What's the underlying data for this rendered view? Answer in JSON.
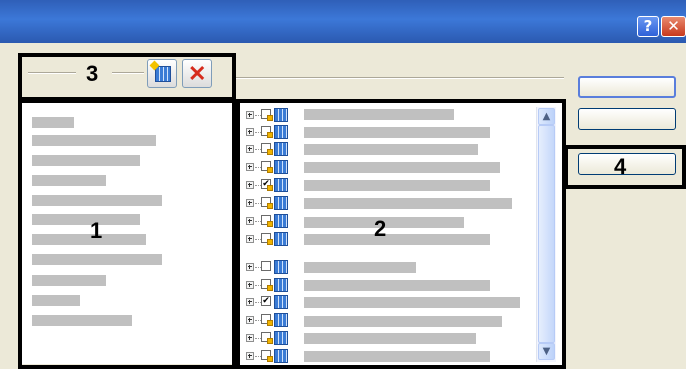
{
  "window": {
    "help_icon": "?",
    "close_icon": "✕"
  },
  "callouts": {
    "list_panel": "1",
    "tree_panel": "2",
    "toolbar": "3",
    "side_button": "4"
  },
  "toolbar": {
    "add_icon": "grid-add-icon",
    "delete_icon": "✕"
  },
  "list": {
    "items": [
      {
        "kind": "redacted-text"
      },
      {
        "kind": "redacted-text"
      },
      {
        "kind": "redacted-text"
      },
      {
        "kind": "redacted-text"
      },
      {
        "kind": "redacted-text"
      },
      {
        "kind": "redacted-text"
      },
      {
        "kind": "redacted-text"
      },
      {
        "kind": "redacted-text"
      },
      {
        "kind": "redacted-text"
      },
      {
        "kind": "redacted-text"
      },
      {
        "kind": "redacted-text"
      },
      {
        "kind": "redacted-text"
      }
    ]
  },
  "tree": {
    "items": [
      {
        "checked": false,
        "locked": true
      },
      {
        "checked": false,
        "locked": true
      },
      {
        "checked": false,
        "locked": true
      },
      {
        "checked": false,
        "locked": true
      },
      {
        "checked": true,
        "locked": true
      },
      {
        "checked": false,
        "locked": true
      },
      {
        "checked": false,
        "locked": true
      },
      {
        "checked": false,
        "locked": true
      },
      {
        "checked": false,
        "locked": false
      },
      {
        "checked": false,
        "locked": true
      },
      {
        "checked": true,
        "locked": false
      },
      {
        "checked": false,
        "locked": true
      },
      {
        "checked": false,
        "locked": true
      },
      {
        "checked": false,
        "locked": true
      },
      {
        "checked": false,
        "locked": true
      }
    ],
    "check_glyph": "✔"
  },
  "scrollbar": {
    "up_icon": "▲",
    "down_icon": "▼"
  },
  "colors": {
    "titlebar": "#3c78d8",
    "dialog_bg": "#ece9d8",
    "callout_border": "#000000",
    "redaction_bar": "#c0c0c0"
  }
}
